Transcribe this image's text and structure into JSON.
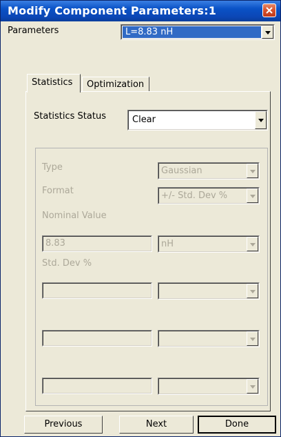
{
  "window": {
    "title": "Modify Component Parameters:1"
  },
  "parameters": {
    "label": "Parameters",
    "selected": "L=8.83 nH"
  },
  "tabs": [
    {
      "label": "Statistics"
    },
    {
      "label": "Optimization"
    }
  ],
  "statistics": {
    "status_label": "Statistics Status",
    "status_value": "Clear",
    "type_label": "Type",
    "type_value": "Gaussian",
    "format_label": "Format",
    "format_value": "+/- Std. Dev %",
    "nominal_label": "Nominal Value",
    "nominal_value": "8.83",
    "nominal_unit": "nH",
    "stddev_label": "Std. Dev %"
  },
  "footer": {
    "previous_label": "Previous",
    "next_label": "Next",
    "done_label": "Done"
  },
  "colors": {
    "title_bar": "#0a52c6",
    "selection": "#316ac5",
    "disabled_text": "#aca899"
  }
}
